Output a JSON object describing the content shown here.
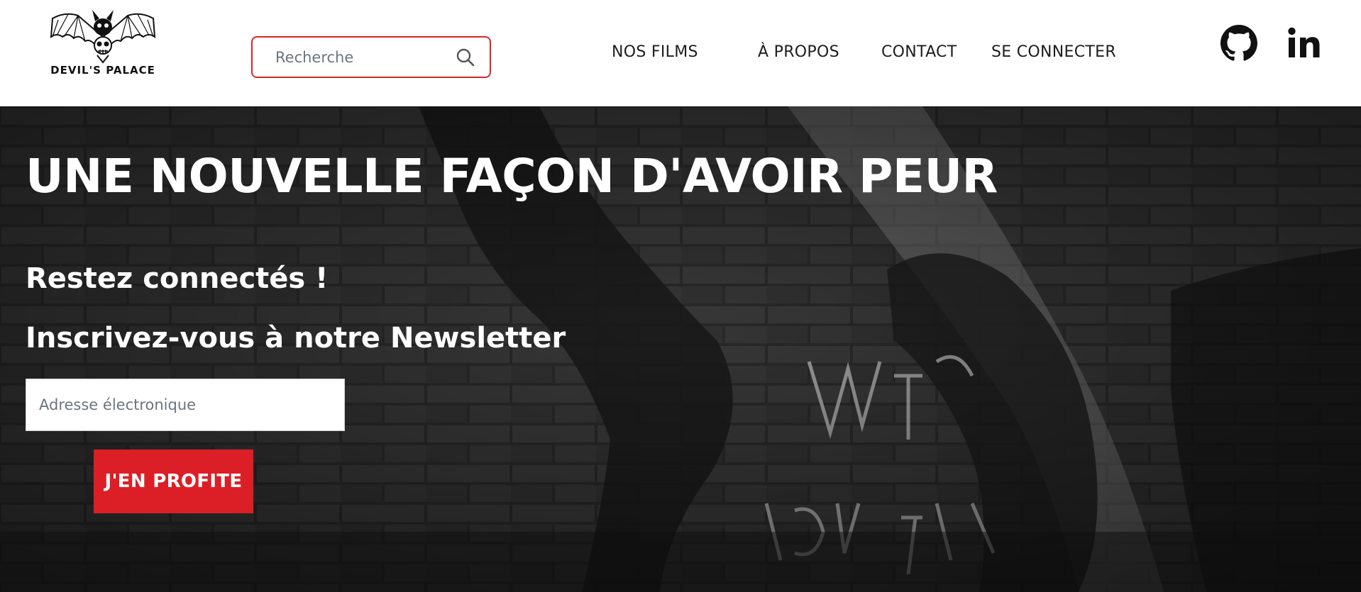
{
  "brand": {
    "name": "DEVIL'S PALACE",
    "logo_icon": "bat-skull-logo-icon"
  },
  "search": {
    "placeholder": "Recherche",
    "value": "",
    "icon": "search-icon",
    "border_color": "#d62828"
  },
  "nav": {
    "items": [
      {
        "label": "NOS FILMS"
      },
      {
        "label": "À PROPOS"
      },
      {
        "label": "CONTACT"
      },
      {
        "label": "SE CONNECTER"
      }
    ]
  },
  "social": {
    "items": [
      {
        "icon": "github-icon"
      },
      {
        "icon": "linkedin-icon"
      }
    ]
  },
  "hero": {
    "title": "UNE NOUVELLE FAÇON D'AVOIR PEUR",
    "subtitle": "Restez connectés !",
    "newsletter_heading": "Inscrivez-vous à notre Newsletter",
    "email_placeholder": "Adresse électronique",
    "email_value": "",
    "cta_label": "J'EN PROFITE",
    "cta_color": "#dc1f26",
    "background": "dark-brick-wall-graffiti"
  }
}
